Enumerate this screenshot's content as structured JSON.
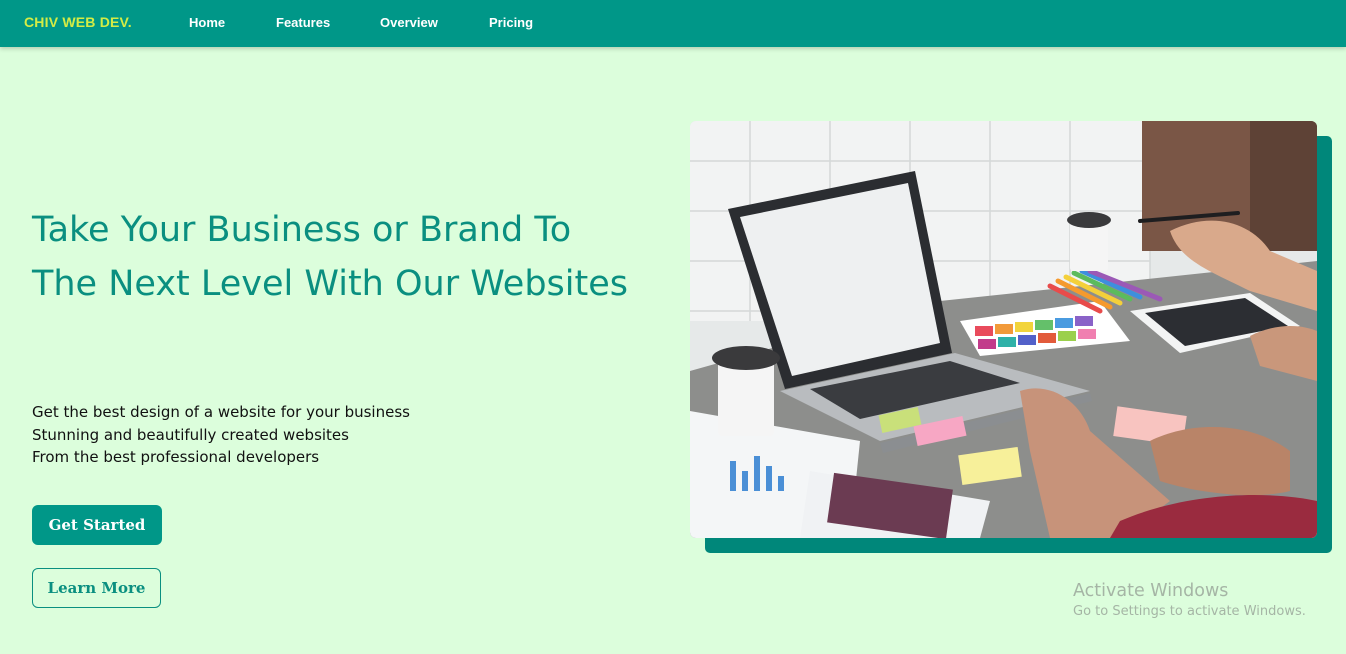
{
  "navbar": {
    "brand": "CHIV WEB DEV.",
    "links": [
      "Home",
      "Features",
      "Overview",
      "Pricing"
    ],
    "bg_color": "#009788",
    "brand_color": "#d4ec45"
  },
  "hero": {
    "title": "Take Your Business or Brand To The Next Level With Our Websites",
    "lines": [
      "Get the best design of a website for your business",
      "Stunning and beautifully created websites",
      "From the best professional developers"
    ],
    "buttons": {
      "primary": "Get Started",
      "secondary": "Learn More"
    },
    "image_subject": "laptop-desk-photo",
    "accent_color": "#0a8f80",
    "page_bg": "#dcfedc"
  },
  "watermark": {
    "title": "Activate Windows",
    "subtitle": "Go to Settings to activate Windows."
  }
}
